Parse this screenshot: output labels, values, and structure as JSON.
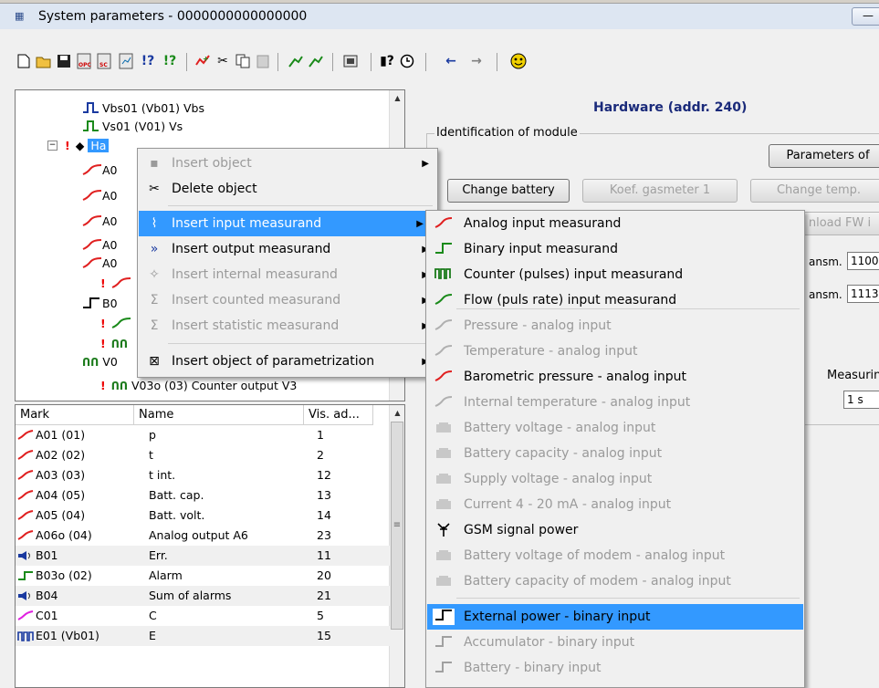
{
  "window": {
    "title": "System parameters - 0000000000000000",
    "minimize": "—"
  },
  "tree": {
    "rows": [
      {
        "label": "Vbs01 (Vb01)  Vbs",
        "icon": "pulse-icon-blue"
      },
      {
        "label": "Vs01 (V01)  Vs",
        "icon": "pulse-icon-green"
      },
      {
        "label": "Ha",
        "icon": "hardware-icon"
      },
      {
        "label": "A0",
        "icon": "analog-icon"
      },
      {
        "label": "A0",
        "icon": "analog-icon"
      },
      {
        "label": "A0",
        "icon": "analog-icon"
      },
      {
        "label": "A0",
        "icon": "analog-icon"
      },
      {
        "label": "A0",
        "icon": "analog-icon"
      },
      {
        "label": "",
        "icon": "warning-icon"
      },
      {
        "label": "B0",
        "icon": "binary-icon"
      },
      {
        "label": "",
        "icon": "analog-icon"
      },
      {
        "label": "",
        "icon": "counter-icon"
      },
      {
        "label": "V0",
        "icon": "counter-icon"
      },
      {
        "label": "V03o (03)  Counter output V3",
        "icon": "counter-icon"
      }
    ]
  },
  "list": {
    "headers": [
      "Mark",
      "Name",
      "Vis. ad..."
    ],
    "rows": [
      {
        "mark": "A01 (01)",
        "name": "p",
        "vis": "1",
        "icon": "analog"
      },
      {
        "mark": "A02 (02)",
        "name": "t",
        "vis": "2",
        "icon": "analog"
      },
      {
        "mark": "A03 (03)",
        "name": "t int.",
        "vis": "12",
        "icon": "analog"
      },
      {
        "mark": "A04 (05)",
        "name": "Batt. cap.",
        "vis": "13",
        "icon": "analog"
      },
      {
        "mark": "A05 (04)",
        "name": "Batt. volt.",
        "vis": "14",
        "icon": "analog"
      },
      {
        "mark": "A06o (04)",
        "name": "Analog output A6",
        "vis": "23",
        "icon": "analog"
      },
      {
        "mark": "B01",
        "name": "Err.",
        "vis": "11",
        "icon": "speaker"
      },
      {
        "mark": "B03o (02)",
        "name": "Alarm",
        "vis": "20",
        "icon": "binary"
      },
      {
        "mark": "B04",
        "name": "Sum of alarms",
        "vis": "21",
        "icon": "speaker"
      },
      {
        "mark": "C01",
        "name": "C",
        "vis": "5",
        "icon": "computed"
      },
      {
        "mark": "E01 (Vb01)",
        "name": "E",
        "vis": "15",
        "icon": "counter"
      }
    ]
  },
  "panel": {
    "title": "Hardware (addr. 240)",
    "group_label": "Identification of module",
    "buttons": {
      "params": "Parameters of",
      "change_battery": "Change battery",
      "koef": "Koef. gasmeter 1",
      "change_temp": "Change temp.",
      "unload": "nload FW i"
    },
    "fields": {
      "transm1_label": "ansm.",
      "transm1_value": "1100",
      "transm2_label": "ansm.",
      "transm2_value": "1113"
    },
    "measuring_label": "Measurin",
    "measuring_value": "1 s"
  },
  "context_menu": {
    "items": [
      {
        "label": "Insert object",
        "disabled": true,
        "submenu": true
      },
      {
        "label": "Delete object",
        "disabled": false,
        "submenu": false
      },
      {
        "label": "Insert input measurand",
        "disabled": false,
        "submenu": true,
        "highlight": true
      },
      {
        "label": "Insert output measurand",
        "disabled": false,
        "submenu": true
      },
      {
        "label": "Insert internal measurand",
        "disabled": true,
        "submenu": true
      },
      {
        "label": "Insert counted measurand",
        "disabled": true,
        "submenu": true
      },
      {
        "label": "Insert statistic measurand",
        "disabled": true,
        "submenu": true
      },
      {
        "label": "Insert object of parametrization",
        "disabled": false,
        "submenu": true
      }
    ]
  },
  "submenu": {
    "items": [
      {
        "label": "Analog input measurand",
        "disabled": false
      },
      {
        "label": "Binary input measurand",
        "disabled": false
      },
      {
        "label": "Counter (pulses) input measurand",
        "disabled": false
      },
      {
        "label": "Flow (puls rate) input measurand",
        "disabled": false
      },
      {
        "label": "Pressure - analog input",
        "disabled": true
      },
      {
        "label": "Temperature - analog input",
        "disabled": true
      },
      {
        "label": "Barometric pressure - analog input",
        "disabled": false
      },
      {
        "label": "Internal temperature - analog input",
        "disabled": true
      },
      {
        "label": "Battery voltage - analog input",
        "disabled": true
      },
      {
        "label": "Battery capacity - analog input",
        "disabled": true
      },
      {
        "label": "Supply voltage - analog input",
        "disabled": true
      },
      {
        "label": "Current 4 - 20 mA - analog input",
        "disabled": true
      },
      {
        "label": "GSM signal power",
        "disabled": false
      },
      {
        "label": "Battery voltage of modem - analog input",
        "disabled": true
      },
      {
        "label": "Battery capacity of modem - analog input",
        "disabled": true
      },
      {
        "label": "External power - binary input",
        "disabled": false,
        "highlight": true
      },
      {
        "label": "Accumulator - binary input",
        "disabled": true
      },
      {
        "label": "Battery - binary input",
        "disabled": true
      }
    ]
  },
  "colors": {
    "highlight": "#3399ff",
    "analog": "#e02020",
    "binary": "#1a8a1a",
    "counter": "#1a7a1a",
    "title": "#1a2a7a"
  }
}
